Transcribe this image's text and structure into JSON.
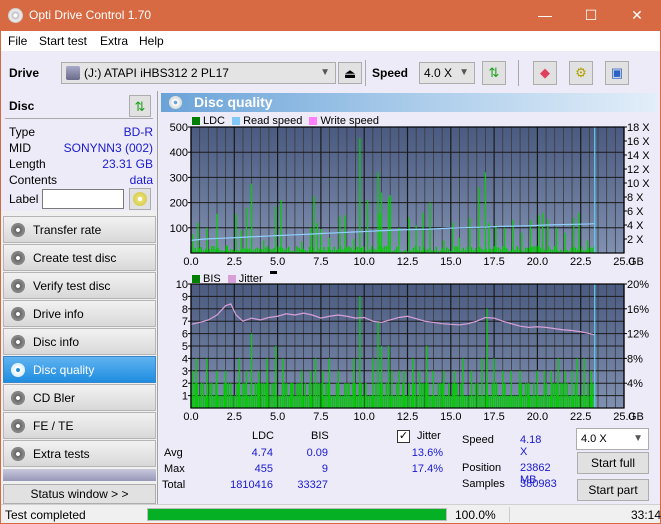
{
  "window": {
    "title": "Opti Drive Control 1.70",
    "minimize": "—",
    "maximize": "☐",
    "close": "✕"
  },
  "menu": [
    "File",
    "Start test",
    "Extra",
    "Help"
  ],
  "toolbar": {
    "drive_label": "Drive",
    "drive_value": "(J:)  ATAPI iHBS312  2 PL17",
    "speed_label": "Speed",
    "speed_value": "4.0 X",
    "eject_glyph": "⏏"
  },
  "disc": {
    "header": "Disc",
    "rows": [
      {
        "key": "Type",
        "value": "BD-R"
      },
      {
        "key": "MID",
        "value": "SONYNN3 (002)"
      },
      {
        "key": "Length",
        "value": "23.31 GB"
      },
      {
        "key": "Contents",
        "value": "data"
      }
    ],
    "label_key": "Label",
    "label_value": ""
  },
  "nav": [
    {
      "label": "Transfer rate",
      "active": false
    },
    {
      "label": "Create test disc",
      "active": false
    },
    {
      "label": "Verify test disc",
      "active": false
    },
    {
      "label": "Drive info",
      "active": false
    },
    {
      "label": "Disc info",
      "active": false
    },
    {
      "label": "Disc quality",
      "active": true
    },
    {
      "label": "CD Bler",
      "active": false
    },
    {
      "label": "FE / TE",
      "active": false
    },
    {
      "label": "Extra tests",
      "active": false
    }
  ],
  "status_window_button": "Status window > >",
  "panel_title": "Disc quality",
  "colors": {
    "ldc": "#00c000",
    "read_speed": "#7fc8f8",
    "write_speed": "#ff80ff",
    "bis": "#00c000",
    "jitter": "#d8a0d8",
    "plot_bg_top": "#4a5a80",
    "plot_bg_bottom": "#8090b0",
    "accent": "#1f8de0"
  },
  "chart_data": [
    {
      "type": "bar",
      "title": "LDC / Read speed",
      "legend": [
        "LDC",
        "Read speed",
        "Write speed"
      ],
      "legend_placement": "top-left",
      "xlabel": "GB",
      "x_ticks": [
        "0.0",
        "2.5",
        "5.0",
        "7.5",
        "10.0",
        "12.5",
        "15.0",
        "17.5",
        "20.0",
        "22.5",
        "25.0"
      ],
      "xlim": [
        0,
        25
      ],
      "y_ticks_left": [
        "100",
        "200",
        "300",
        "400",
        "500"
      ],
      "ylim_left": [
        0,
        500
      ],
      "y_ticks_right": [
        "2 X",
        "4 X",
        "6 X",
        "8 X",
        "10 X",
        "12 X",
        "14 X",
        "16 X",
        "18 X"
      ],
      "ylim_right": [
        0,
        18
      ],
      "grid": true,
      "end_marker_gb": 23.31,
      "series": [
        {
          "name": "LDC",
          "x": [
            0.1,
            0.4,
            0.9,
            1.5,
            2.1,
            2.6,
            2.9,
            3.2,
            3.5,
            4.2,
            4.9,
            5.2,
            6.4,
            6.9,
            7.1,
            7.3,
            7.5,
            8.0,
            8.6,
            8.9,
            9.4,
            9.75,
            10.2,
            10.8,
            10.9,
            11.0,
            11.4,
            11.5,
            12.0,
            12.6,
            13.0,
            13.4,
            13.8,
            14.6,
            15.1,
            15.5,
            16.1,
            16.6,
            17.0,
            17.2,
            17.6,
            18.1,
            18.6,
            19.1,
            19.6,
            20.1,
            20.3,
            20.6,
            21.1,
            21.6,
            22.1,
            22.4,
            22.9,
            23.3
          ],
          "y": [
            75,
            120,
            100,
            155,
            30,
            155,
            90,
            180,
            275,
            50,
            185,
            210,
            45,
            100,
            225,
            120,
            95,
            60,
            145,
            150,
            55,
            455,
            210,
            320,
            155,
            240,
            220,
            230,
            100,
            140,
            110,
            160,
            200,
            50,
            120,
            60,
            140,
            260,
            320,
            120,
            110,
            100,
            130,
            80,
            130,
            150,
            160,
            135,
            100,
            80,
            140,
            160,
            50,
            30
          ]
        },
        {
          "name": "Read speed",
          "x": [
            0,
            0.8,
            1.7,
            2.6,
            3.4,
            4.3,
            5.1,
            6.0,
            6.9,
            7.7,
            8.6,
            9.4,
            10.3,
            11.1,
            12.0,
            12.8,
            13.7,
            14.5,
            15.4,
            16.2,
            17.1,
            17.9,
            18.8,
            19.6,
            20.5,
            21.3,
            22.2,
            23.0,
            23.31
          ],
          "y": [
            1.8,
            2.0,
            2.1,
            2.2,
            2.3,
            2.4,
            2.5,
            2.6,
            2.7,
            2.8,
            2.9,
            3.0,
            3.1,
            3.2,
            3.3,
            3.35,
            3.4,
            3.5,
            3.6,
            3.65,
            3.7,
            3.8,
            3.85,
            3.9,
            4.0,
            4.05,
            4.1,
            4.15,
            4.2
          ]
        }
      ]
    },
    {
      "type": "bar",
      "title": "BIS / Jitter",
      "legend": [
        "BIS",
        "Jitter"
      ],
      "legend_placement": "top-left",
      "xlabel": "GB",
      "x_ticks": [
        "0.0",
        "2.5",
        "5.0",
        "7.5",
        "10.0",
        "12.5",
        "15.0",
        "17.5",
        "20.0",
        "22.5",
        "25.0"
      ],
      "xlim": [
        0,
        25
      ],
      "y_ticks_left": [
        "1",
        "2",
        "3",
        "4",
        "5",
        "6",
        "7",
        "8",
        "9",
        "10"
      ],
      "ylim_left": [
        0,
        10
      ],
      "y_ticks_right": [
        "4%",
        "8%",
        "12%",
        "16%",
        "20%"
      ],
      "ylim_right": [
        0,
        20
      ],
      "grid": true,
      "end_marker_gb": 23.31,
      "series": [
        {
          "name": "BIS",
          "x": [
            0.1,
            0.3,
            0.6,
            0.9,
            1.2,
            1.5,
            2.0,
            2.3,
            2.8,
            3.2,
            3.5,
            3.9,
            4.4,
            4.9,
            5.3,
            5.8,
            6.4,
            6.9,
            7.2,
            7.6,
            8.0,
            8.5,
            9.0,
            9.4,
            9.75,
            10.1,
            10.5,
            10.8,
            11.0,
            11.4,
            11.6,
            12.0,
            12.3,
            12.8,
            13.2,
            13.6,
            14.0,
            14.6,
            15.2,
            15.7,
            16.2,
            16.8,
            17.1,
            17.5,
            18.0,
            18.5,
            19.0,
            19.5,
            20.0,
            20.4,
            20.8,
            21.2,
            21.6,
            22.0,
            22.3,
            22.7,
            23.1
          ],
          "y": [
            3,
            4,
            2,
            4,
            2,
            3,
            3,
            2,
            4,
            3,
            6,
            3,
            4,
            5,
            4,
            2,
            3,
            3,
            4,
            3,
            4,
            3,
            2,
            4,
            9,
            2,
            4,
            7,
            5,
            5,
            3,
            3,
            3,
            4,
            3,
            5,
            3,
            3,
            3,
            4,
            3,
            4,
            8,
            4,
            3,
            3,
            3,
            2,
            3,
            3,
            3,
            4,
            3,
            3,
            4,
            4,
            3
          ]
        },
        {
          "name": "Jitter",
          "unit": "%",
          "x": [
            0,
            0.5,
            1.0,
            1.5,
            2.0,
            2.3,
            2.6,
            3.0,
            3.5,
            4.0,
            4.5,
            5.0,
            5.5,
            6.0,
            6.5,
            7.0,
            7.5,
            8.0,
            8.5,
            9.0,
            9.5,
            10.0,
            10.5,
            11.0,
            11.5,
            12.0,
            12.5,
            13.0,
            13.5,
            14.0,
            14.5,
            15.0,
            15.5,
            16.0,
            16.5,
            17.0,
            17.5,
            18.0,
            18.5,
            19.0,
            19.5,
            20.0,
            20.5,
            21.0,
            21.5,
            22.0,
            22.5,
            23.0,
            23.3
          ],
          "y": [
            13.5,
            13.8,
            14.2,
            15.0,
            16.5,
            16.8,
            15.0,
            14.0,
            14.5,
            14.2,
            14.6,
            14.8,
            15.2,
            15.0,
            15.3,
            15.0,
            14.5,
            14.8,
            15.0,
            14.8,
            14.5,
            14.6,
            14.0,
            13.8,
            14.2,
            14.6,
            14.8,
            14.4,
            14.0,
            13.8,
            13.6,
            13.5,
            13.4,
            13.6,
            14.0,
            14.6,
            14.5,
            14.0,
            13.6,
            13.2,
            13.0,
            13.1,
            13.0,
            12.8,
            12.6,
            12.5,
            12.3,
            12.0,
            11.8
          ]
        }
      ]
    }
  ],
  "stats": {
    "col_ldc": "LDC",
    "col_bis": "BIS",
    "jitter_label": "Jitter",
    "jitter_checked": true,
    "rows": [
      {
        "label": "Avg",
        "ldc": "4.74",
        "bis": "0.09",
        "jitter": "13.6%"
      },
      {
        "label": "Max",
        "ldc": "455",
        "bis": "9",
        "jitter": "17.4%"
      },
      {
        "label": "Total",
        "ldc": "1810416",
        "bis": "33327",
        "jitter": ""
      }
    ],
    "speed_label": "Speed",
    "speed_value": "4.18 X",
    "position_label": "Position",
    "position_value": "23862 MB",
    "samples_label": "Samples",
    "samples_value": "380983",
    "speed_select": "4.0 X",
    "start_full": "Start full",
    "start_part": "Start part"
  },
  "statusbar": {
    "text": "Test completed",
    "progress_percent": 100.0,
    "progress_text": "100.0%",
    "time": "33:14"
  }
}
